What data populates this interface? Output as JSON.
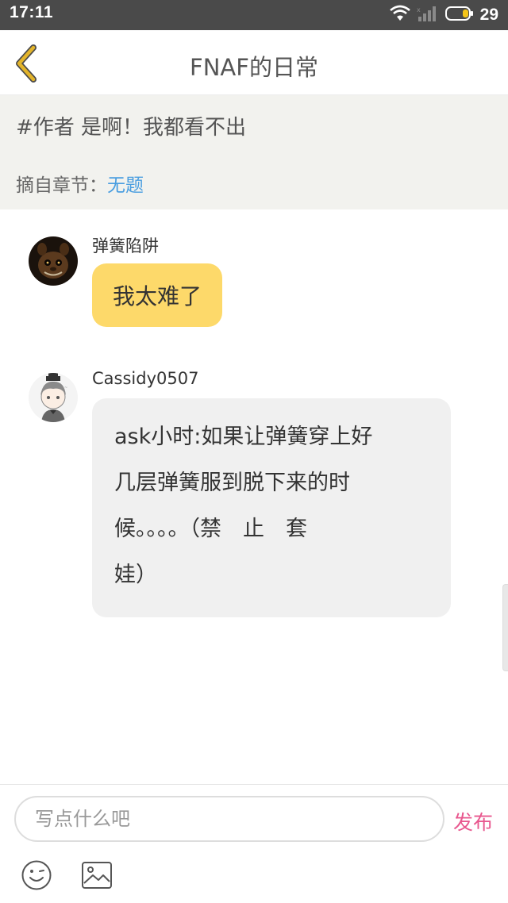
{
  "status_bar": {
    "time": "17:11",
    "battery_percent": "29",
    "icons": [
      "wifi-icon",
      "signal-icon",
      "battery-icon"
    ],
    "battery_color": "#f5c518"
  },
  "header": {
    "title": "FNAF的日常",
    "back_icon": "chevron-left-icon",
    "back_color": "#e3b42a"
  },
  "quote": {
    "text": "#作者 是啊！我都看不出",
    "chapter_label": "摘自章节：",
    "chapter_link": "无题",
    "link_color": "#4a9ee0"
  },
  "messages": [
    {
      "sender": "弹簧陷阱",
      "avatar_icon": "springtrap-avatar",
      "bubble_color": "#fdd96a",
      "lines": [
        "我太难了"
      ]
    },
    {
      "sender": "Cassidy0507",
      "avatar_icon": "anime-character-avatar",
      "bubble_color": "#f0f0f0",
      "lines": [
        "ask小时:如果让弹簧穿上好",
        "几层弹簧服到脱下来的时",
        "候。。。。（禁　止　套",
        "娃）"
      ]
    }
  ],
  "composer": {
    "placeholder": "写点什么吧",
    "publish_label": "发布",
    "publish_color": "#e8578e",
    "icons": [
      "emoji-icon",
      "image-icon"
    ]
  }
}
